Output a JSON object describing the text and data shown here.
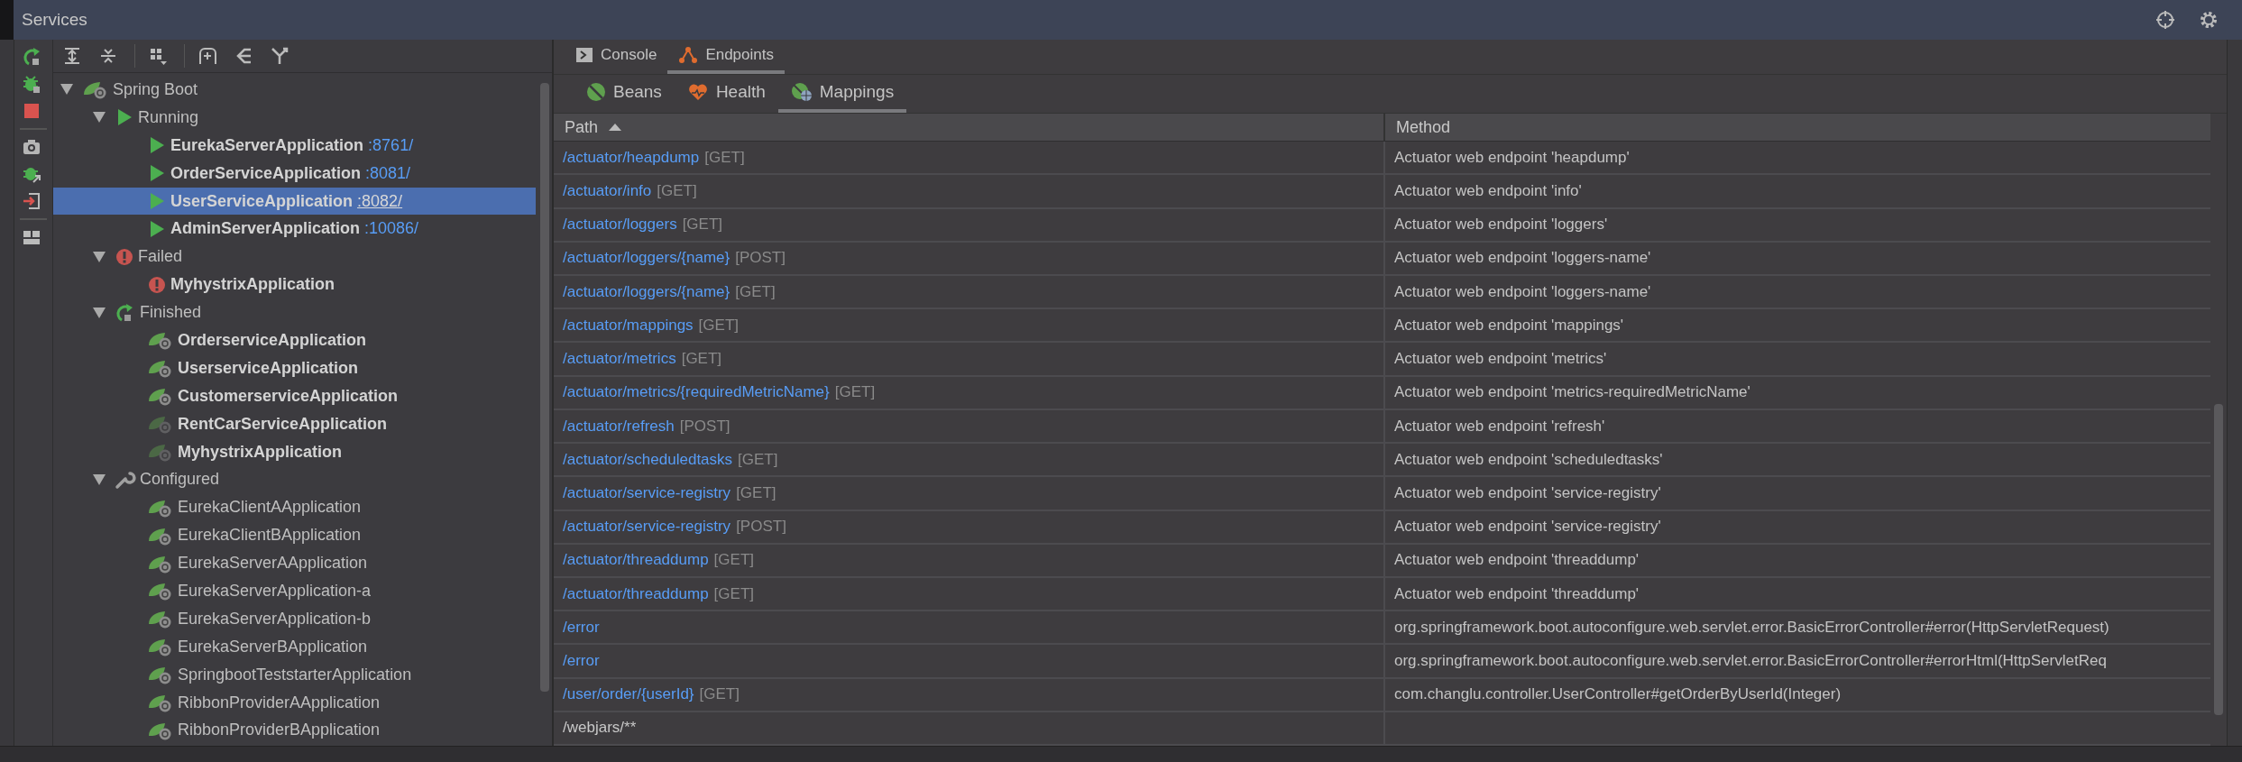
{
  "window": {
    "title": "Services"
  },
  "tree": [
    {
      "label": "Spring Boot",
      "kind": "spring",
      "bold": false,
      "expanded": true,
      "selected": false,
      "children": [
        {
          "label": "Running",
          "kind": "run",
          "bold": false,
          "expanded": true,
          "selected": false,
          "children": [
            {
              "label": "EurekaServerApplication",
              "port": ":8761/",
              "kind": "run",
              "bold": true,
              "selected": false
            },
            {
              "label": "OrderServiceApplication",
              "port": ":8081/",
              "kind": "run",
              "bold": true,
              "selected": false
            },
            {
              "label": "UserServiceApplication",
              "port": ":8082/",
              "kind": "run",
              "bold": true,
              "selected": true
            },
            {
              "label": "AdminServerApplication",
              "port": ":10086/",
              "kind": "run",
              "bold": true,
              "selected": false
            }
          ]
        },
        {
          "label": "Failed",
          "kind": "error",
          "bold": false,
          "expanded": true,
          "selected": false,
          "children": [
            {
              "label": "MyhystrixApplication",
              "kind": "error",
              "bold": true,
              "selected": false
            }
          ]
        },
        {
          "label": "Finished",
          "kind": "rerun",
          "bold": false,
          "expanded": true,
          "selected": false,
          "children": [
            {
              "label": "OrderserviceApplication",
              "kind": "spring",
              "bold": true,
              "selected": false
            },
            {
              "label": "UserserviceApplication",
              "kind": "spring",
              "bold": true,
              "selected": false
            },
            {
              "label": "CustomerserviceApplication",
              "kind": "spring",
              "bold": true,
              "selected": false
            },
            {
              "label": "RentCarServiceApplication",
              "kind": "faded",
              "bold": true,
              "selected": false
            },
            {
              "label": "MyhystrixApplication",
              "kind": "faded",
              "bold": true,
              "selected": false
            }
          ]
        },
        {
          "label": "Configured",
          "kind": "wrench",
          "bold": false,
          "expanded": true,
          "selected": false,
          "children": [
            {
              "label": "EurekaClientAApplication",
              "kind": "spring",
              "bold": false,
              "selected": false
            },
            {
              "label": "EurekaClientBApplication",
              "kind": "spring",
              "bold": false,
              "selected": false
            },
            {
              "label": "EurekaServerAApplication",
              "kind": "spring",
              "bold": false,
              "selected": false
            },
            {
              "label": "EurekaServerApplication-a",
              "kind": "spring",
              "bold": false,
              "selected": false
            },
            {
              "label": "EurekaServerApplication-b",
              "kind": "spring",
              "bold": false,
              "selected": false
            },
            {
              "label": "EurekaServerBApplication",
              "kind": "spring",
              "bold": false,
              "selected": false
            },
            {
              "label": "SpringbootTeststarterApplication",
              "kind": "spring",
              "bold": false,
              "selected": false
            },
            {
              "label": "RibbonProviderAApplication",
              "kind": "spring",
              "bold": false,
              "selected": false
            },
            {
              "label": "RibbonProviderBApplication",
              "kind": "spring",
              "bold": false,
              "selected": false
            }
          ]
        }
      ]
    }
  ],
  "tabs": [
    {
      "label": "Console",
      "kind": "console",
      "selected": false
    },
    {
      "label": "Endpoints",
      "kind": "endpoints",
      "selected": true
    }
  ],
  "subtabs": [
    {
      "label": "Beans",
      "kind": "beans",
      "selected": false
    },
    {
      "label": "Health",
      "kind": "health",
      "selected": false
    },
    {
      "label": "Mappings",
      "kind": "mappings",
      "selected": true
    }
  ],
  "table": {
    "columns": [
      {
        "label": "Path",
        "sorted": true
      },
      {
        "label": "Method",
        "sorted": false
      }
    ],
    "rows": [
      {
        "path": "/actuator/heapdump",
        "link": true,
        "verb": "[GET]",
        "method": "Actuator web endpoint 'heapdump'"
      },
      {
        "path": "/actuator/info",
        "link": true,
        "verb": "[GET]",
        "method": "Actuator web endpoint 'info'"
      },
      {
        "path": "/actuator/loggers",
        "link": true,
        "verb": "[GET]",
        "method": "Actuator web endpoint 'loggers'"
      },
      {
        "path": "/actuator/loggers/{name}",
        "link": true,
        "verb": "[POST]",
        "method": "Actuator web endpoint 'loggers-name'"
      },
      {
        "path": "/actuator/loggers/{name}",
        "link": true,
        "verb": "[GET]",
        "method": "Actuator web endpoint 'loggers-name'"
      },
      {
        "path": "/actuator/mappings",
        "link": true,
        "verb": "[GET]",
        "method": "Actuator web endpoint 'mappings'"
      },
      {
        "path": "/actuator/metrics",
        "link": true,
        "verb": "[GET]",
        "method": "Actuator web endpoint 'metrics'"
      },
      {
        "path": "/actuator/metrics/{requiredMetricName}",
        "link": true,
        "verb": "[GET]",
        "method": "Actuator web endpoint 'metrics-requiredMetricName'"
      },
      {
        "path": "/actuator/refresh",
        "link": true,
        "verb": "[POST]",
        "method": "Actuator web endpoint 'refresh'"
      },
      {
        "path": "/actuator/scheduledtasks",
        "link": true,
        "verb": "[GET]",
        "method": "Actuator web endpoint 'scheduledtasks'"
      },
      {
        "path": "/actuator/service-registry",
        "link": true,
        "verb": "[GET]",
        "method": "Actuator web endpoint 'service-registry'"
      },
      {
        "path": "/actuator/service-registry",
        "link": true,
        "verb": "[POST]",
        "method": "Actuator web endpoint 'service-registry'"
      },
      {
        "path": "/actuator/threaddump",
        "link": true,
        "verb": "[GET]",
        "method": "Actuator web endpoint 'threaddump'"
      },
      {
        "path": "/actuator/threaddump",
        "link": true,
        "verb": "[GET]",
        "method": "Actuator web endpoint 'threaddump'"
      },
      {
        "path": "/error",
        "link": true,
        "method": "org.springframework.boot.autoconfigure.web.servlet.error.BasicErrorController#error(HttpServletRequest)"
      },
      {
        "path": "/error",
        "link": true,
        "method": "org.springframework.boot.autoconfigure.web.servlet.error.BasicErrorController#errorHtml(HttpServletReq"
      },
      {
        "path": "/user/order/{userId}",
        "link": true,
        "verb": "[GET]",
        "method": "com.changlu.controller.UserController#getOrderByUserId(Integer)"
      },
      {
        "path": "/webjars/**",
        "link": false
      }
    ]
  }
}
